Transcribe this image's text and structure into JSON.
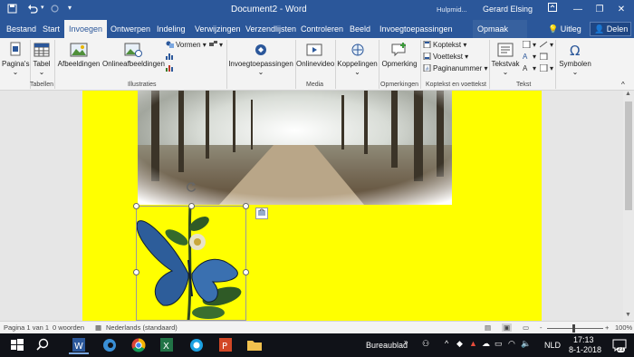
{
  "window": {
    "title": "Document2 - Word",
    "context_tool": "Hulpmid...",
    "user": "Gerard Elsing"
  },
  "tabs": [
    {
      "label": "Bestand"
    },
    {
      "label": "Start"
    },
    {
      "label": "Invoegen"
    },
    {
      "label": "Ontwerpen"
    },
    {
      "label": "Indeling"
    },
    {
      "label": "Verwijzingen"
    },
    {
      "label": "Verzendlijsten"
    },
    {
      "label": "Controleren"
    },
    {
      "label": "Beeld"
    },
    {
      "label": "Invoegtoepassingen"
    },
    {
      "label": "Opmaak"
    }
  ],
  "tellme": "Uitleg",
  "share": "Delen",
  "ribbon": {
    "pages": "Pagina's",
    "table": "Tabel",
    "pictures": "Afbeeldingen",
    "online_pictures": "Onlineafbeeldingen",
    "shapes": "Vormen",
    "addins": "Invoegtoepassingen",
    "online_video": "Onlinevideo",
    "links": "Koppelingen",
    "comment": "Opmerking",
    "header": "Koptekst",
    "footer": "Voettekst",
    "page_number": "Paginanummer",
    "textbox": "Tekstvak",
    "symbols": "Symbolen",
    "groups": {
      "tables": "Tabellen",
      "illustrations": "Illustraties",
      "media": "Media",
      "comments": "Opmerkingen",
      "header_footer": "Koptekst en voettekst",
      "text": "Tekst"
    }
  },
  "status": {
    "page": "Pagina 1 van 1",
    "words": "0 woorden",
    "language": "Nederlands (standaard)",
    "zoom_percent": "100%",
    "zoom_minus": "-",
    "zoom_plus": "+"
  },
  "taskbar": {
    "desktop_label": "Bureaublad",
    "lang": "NLD",
    "time": "17:13",
    "date": "8-1-2018",
    "notif_count": "21"
  },
  "colors": {
    "word_blue": "#2b579a",
    "page_bg": "#ffff00",
    "taskbar": "#101218"
  }
}
